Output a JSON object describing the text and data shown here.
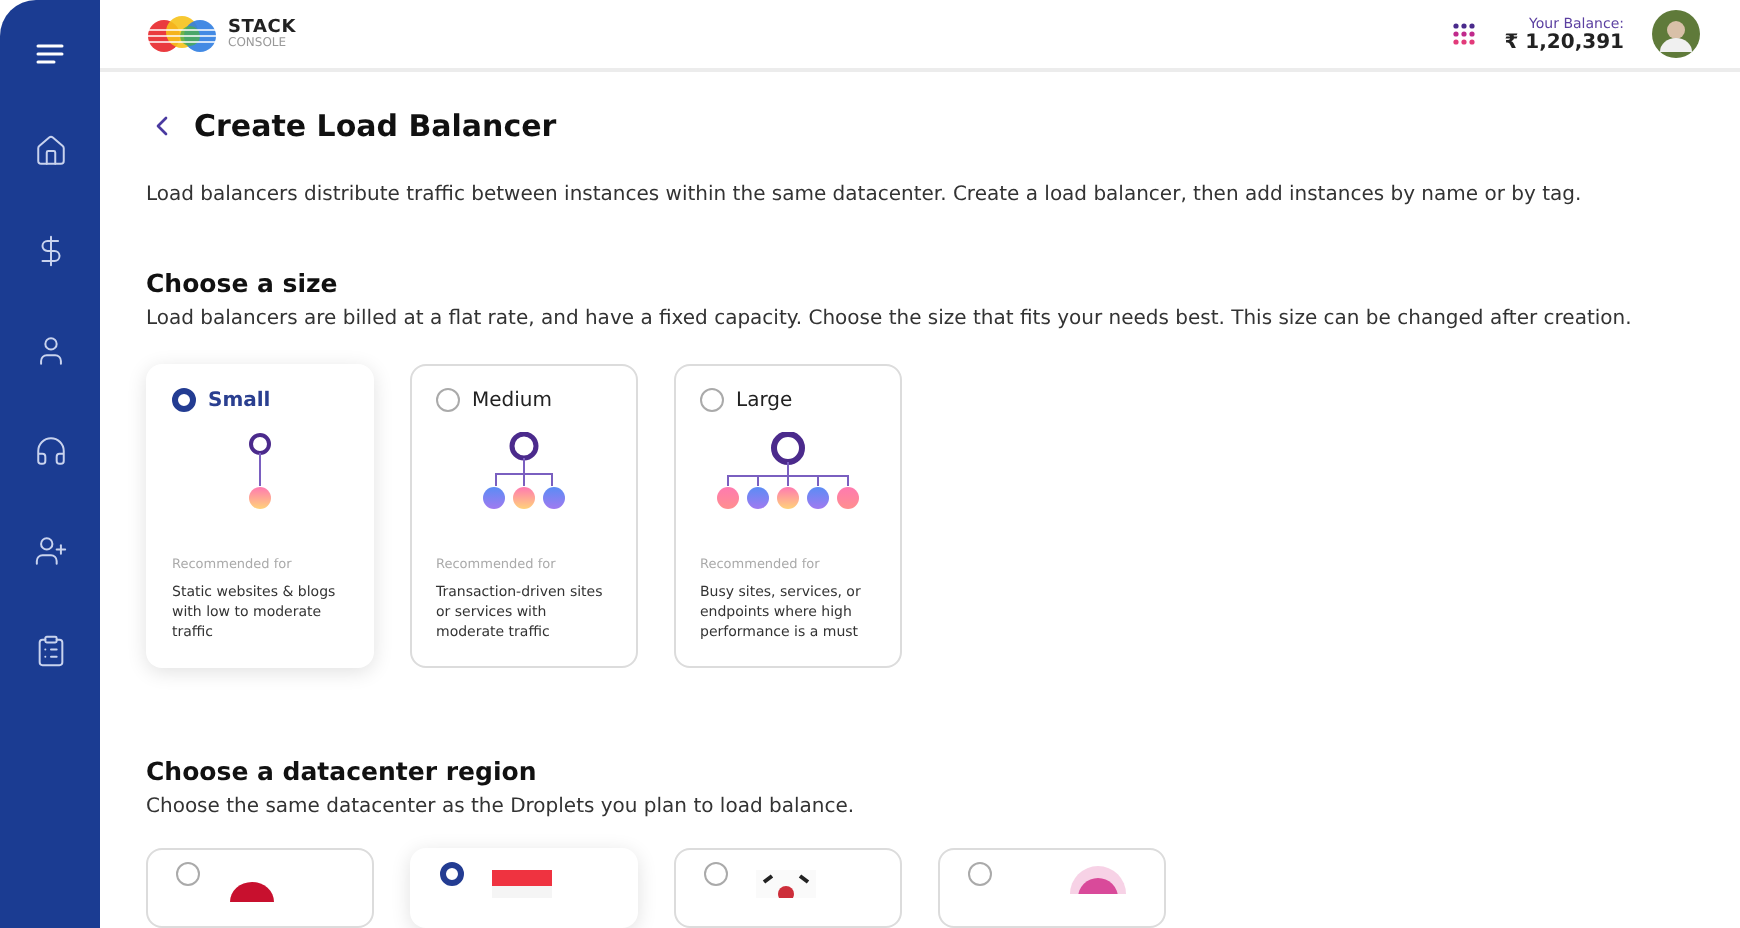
{
  "brand": {
    "name": "STACK",
    "sub": "CONSOLE"
  },
  "balance": {
    "label": "Your Balance:",
    "amount": "₹ 1,20,391"
  },
  "sidebar": {
    "items": [
      {
        "kind": "home"
      },
      {
        "kind": "dollar"
      },
      {
        "kind": "user"
      },
      {
        "kind": "headset"
      },
      {
        "kind": "add-user"
      },
      {
        "kind": "clipboard"
      }
    ]
  },
  "page": {
    "title": "Create Load Balancer",
    "intro": "Load balancers distribute traffic between instances within the same datacenter. Create a load balancer, then add instances by name or by tag."
  },
  "size_section": {
    "title": "Choose a size",
    "description": "Load balancers are billed at a flat rate, and have a fixed capacity. Choose the size that fits your needs best. This size can be changed after creation.",
    "options": [
      {
        "label": "Small",
        "kind": "small",
        "selected": true,
        "caption": "Recommended for",
        "text": "Static websites & blogs with low to moderate traffic"
      },
      {
        "label": "Medium",
        "kind": "medium",
        "selected": false,
        "caption": "Recommended for",
        "text": "Transaction-driven sites or services with moderate traffic"
      },
      {
        "label": "Large",
        "kind": "large",
        "selected": false,
        "caption": "Recommended for",
        "text": "Busy sites, services, or endpoints where high performance is a must"
      }
    ]
  },
  "region_section": {
    "title": "Choose a datacenter region",
    "description": "Choose the same datacenter as the Droplets you plan to load balance.",
    "regions": [
      {
        "kind": "red-disc",
        "selected": false
      },
      {
        "kind": "red-white",
        "selected": true
      },
      {
        "kind": "white-emblem",
        "selected": false
      },
      {
        "kind": "pink-disc",
        "selected": false
      }
    ]
  }
}
